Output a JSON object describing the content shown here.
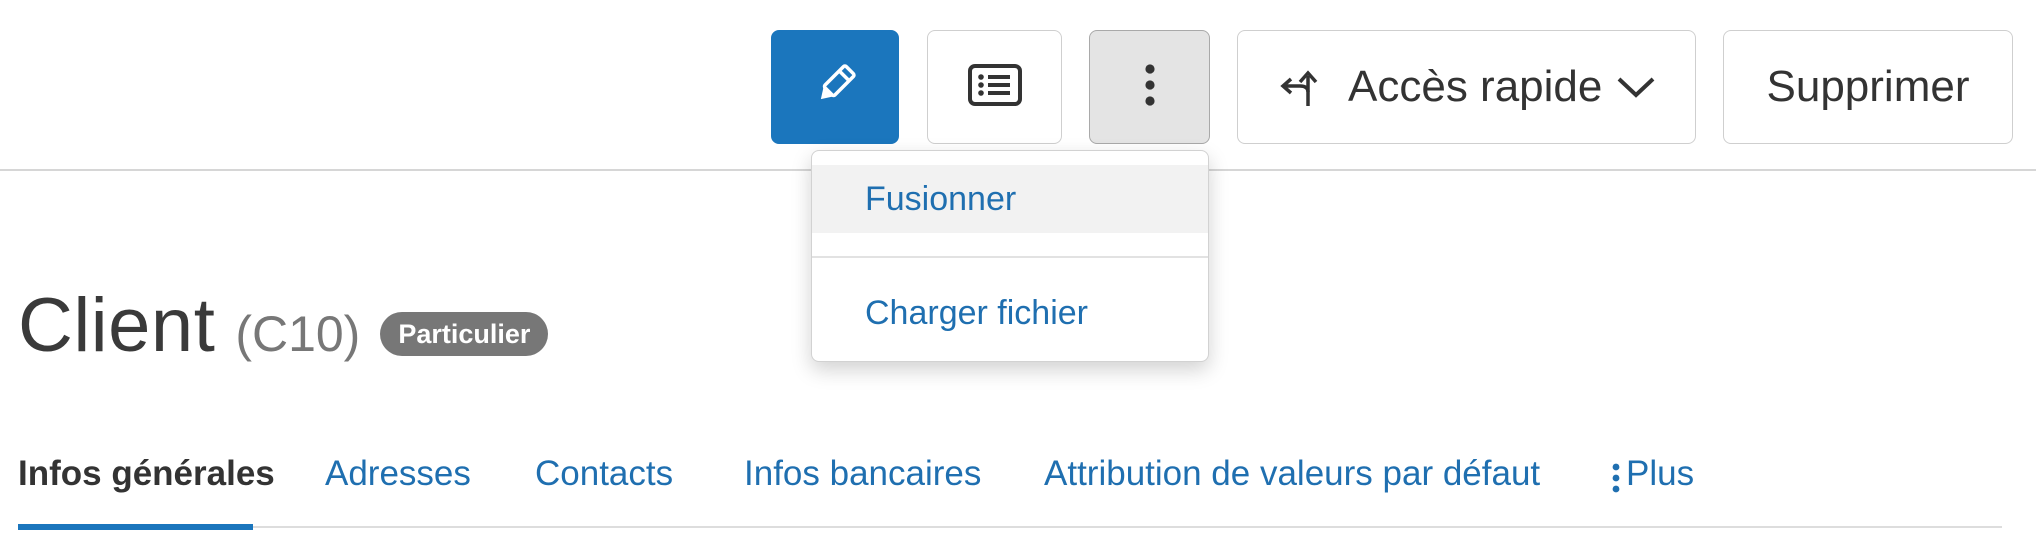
{
  "toolbar": {
    "edit_icon": "pencil-icon",
    "list_icon": "list-icon",
    "more_icon": "vertical-dots-icon",
    "quick_access_label": "Accès rapide",
    "quick_access_icon": "branch-arrow-icon",
    "delete_label": "Supprimer",
    "accent_color": "#1b76bd"
  },
  "dropdown": {
    "items": [
      {
        "label": "Fusionner"
      },
      {
        "label": "Charger fichier"
      }
    ]
  },
  "header": {
    "title": "Client",
    "code": "(C10)",
    "badge": "Particulier"
  },
  "tabs": [
    {
      "label": "Infos générales",
      "active": true
    },
    {
      "label": "Adresses"
    },
    {
      "label": "Contacts"
    },
    {
      "label": "Infos bancaires"
    },
    {
      "label": "Attribution de valeurs par défaut"
    },
    {
      "label": "Plus"
    }
  ]
}
